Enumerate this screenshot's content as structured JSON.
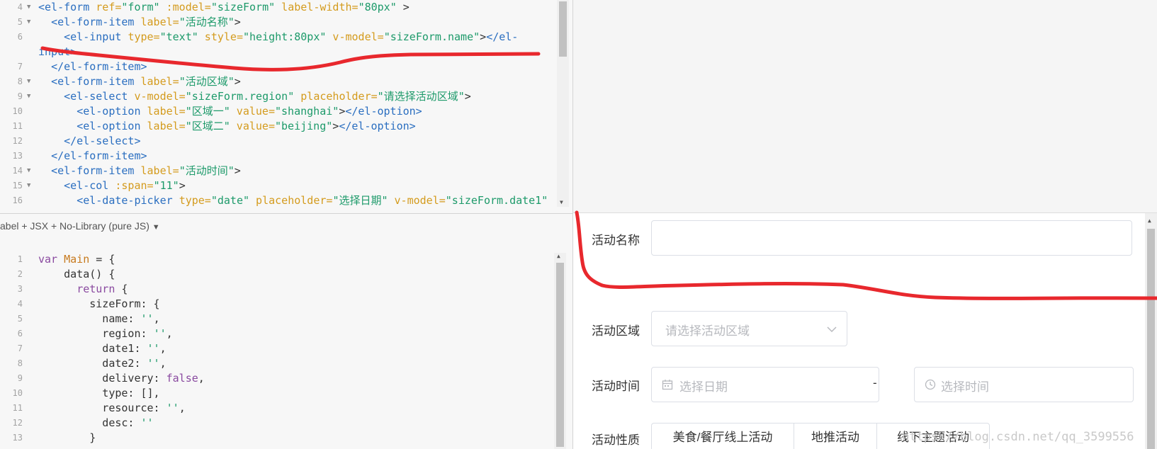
{
  "html_editor": {
    "lines": [
      {
        "n": "4",
        "fold": true,
        "segs": [
          [
            "tag",
            "<el-form "
          ],
          [
            "attr",
            "ref="
          ],
          [
            "str",
            "\"form\""
          ],
          [
            "attr",
            " :model="
          ],
          [
            "str",
            "\"sizeForm\""
          ],
          [
            "attr",
            " label-width="
          ],
          [
            "str",
            "\"80px\""
          ],
          [
            "pl",
            " >"
          ]
        ]
      },
      {
        "n": "5",
        "fold": true,
        "segs": [
          [
            "pl",
            "  "
          ],
          [
            "tag",
            "<el-form-item "
          ],
          [
            "attr",
            "label="
          ],
          [
            "str",
            "\"活动名称\""
          ],
          [
            "pl",
            ">"
          ]
        ]
      },
      {
        "n": "6",
        "fold": false,
        "segs": [
          [
            "pl",
            "    "
          ],
          [
            "tag",
            "<el-input "
          ],
          [
            "attr",
            "type="
          ],
          [
            "str",
            "\"text\""
          ],
          [
            "attr",
            " style="
          ],
          [
            "str",
            "\"height:80px\""
          ],
          [
            "attr",
            " v-model="
          ],
          [
            "str",
            "\"sizeForm.name\""
          ],
          [
            "pl",
            ">"
          ],
          [
            "tag",
            "</el-"
          ]
        ]
      },
      {
        "n": "",
        "fold": false,
        "segs": [
          [
            "tag",
            "input>"
          ]
        ]
      },
      {
        "n": "7",
        "fold": false,
        "segs": [
          [
            "pl",
            "  "
          ],
          [
            "tag",
            "</el-form-item>"
          ]
        ]
      },
      {
        "n": "8",
        "fold": true,
        "segs": [
          [
            "pl",
            "  "
          ],
          [
            "tag",
            "<el-form-item "
          ],
          [
            "attr",
            "label="
          ],
          [
            "str",
            "\"活动区域\""
          ],
          [
            "pl",
            ">"
          ]
        ]
      },
      {
        "n": "9",
        "fold": true,
        "segs": [
          [
            "pl",
            "    "
          ],
          [
            "tag",
            "<el-select "
          ],
          [
            "attr",
            "v-model="
          ],
          [
            "str",
            "\"sizeForm.region\""
          ],
          [
            "attr",
            " placeholder="
          ],
          [
            "str",
            "\"请选择活动区域\""
          ],
          [
            "pl",
            ">"
          ]
        ]
      },
      {
        "n": "10",
        "fold": false,
        "segs": [
          [
            "pl",
            "      "
          ],
          [
            "tag",
            "<el-option "
          ],
          [
            "attr",
            "label="
          ],
          [
            "str",
            "\"区域一\""
          ],
          [
            "attr",
            " value="
          ],
          [
            "str",
            "\"shanghai\""
          ],
          [
            "pl",
            ">"
          ],
          [
            "tag",
            "</el-option>"
          ]
        ]
      },
      {
        "n": "11",
        "fold": false,
        "segs": [
          [
            "pl",
            "      "
          ],
          [
            "tag",
            "<el-option "
          ],
          [
            "attr",
            "label="
          ],
          [
            "str",
            "\"区域二\""
          ],
          [
            "attr",
            " value="
          ],
          [
            "str",
            "\"beijing\""
          ],
          [
            "pl",
            ">"
          ],
          [
            "tag",
            "</el-option>"
          ]
        ]
      },
      {
        "n": "12",
        "fold": false,
        "segs": [
          [
            "pl",
            "    "
          ],
          [
            "tag",
            "</el-select>"
          ]
        ]
      },
      {
        "n": "13",
        "fold": false,
        "segs": [
          [
            "pl",
            "  "
          ],
          [
            "tag",
            "</el-form-item>"
          ]
        ]
      },
      {
        "n": "14",
        "fold": true,
        "segs": [
          [
            "pl",
            "  "
          ],
          [
            "tag",
            "<el-form-item "
          ],
          [
            "attr",
            "label="
          ],
          [
            "str",
            "\"活动时间\""
          ],
          [
            "pl",
            ">"
          ]
        ]
      },
      {
        "n": "15",
        "fold": true,
        "segs": [
          [
            "pl",
            "    "
          ],
          [
            "tag",
            "<el-col "
          ],
          [
            "attr",
            ":span="
          ],
          [
            "str",
            "\"11\""
          ],
          [
            "pl",
            ">"
          ]
        ]
      },
      {
        "n": "16",
        "fold": false,
        "segs": [
          [
            "pl",
            "      "
          ],
          [
            "tag",
            "<el-date-picker "
          ],
          [
            "attr",
            "type="
          ],
          [
            "str",
            "\"date\""
          ],
          [
            "attr",
            " placeholder="
          ],
          [
            "str",
            "\"选择日期\""
          ],
          [
            "attr",
            " v-model="
          ],
          [
            "str",
            "\"sizeForm.date1\""
          ]
        ]
      }
    ]
  },
  "js_editor": {
    "header": "abel + JSX + No-Library (pure JS)",
    "lines": [
      {
        "n": "1",
        "segs": [
          [
            "kw",
            "var "
          ],
          [
            "var",
            "Main"
          ],
          [
            "pl",
            " = {"
          ]
        ]
      },
      {
        "n": "2",
        "segs": [
          [
            "pl",
            "    data() {"
          ]
        ]
      },
      {
        "n": "3",
        "segs": [
          [
            "pl",
            "      "
          ],
          [
            "kw",
            "return"
          ],
          [
            "pl",
            " {"
          ]
        ]
      },
      {
        "n": "4",
        "segs": [
          [
            "pl",
            "        sizeForm: {"
          ]
        ]
      },
      {
        "n": "5",
        "segs": [
          [
            "pl",
            "          name: "
          ],
          [
            "str",
            "''"
          ],
          [
            "pl",
            ","
          ]
        ]
      },
      {
        "n": "6",
        "segs": [
          [
            "pl",
            "          region: "
          ],
          [
            "str",
            "''"
          ],
          [
            "pl",
            ","
          ]
        ]
      },
      {
        "n": "7",
        "segs": [
          [
            "pl",
            "          date1: "
          ],
          [
            "str",
            "''"
          ],
          [
            "pl",
            ","
          ]
        ]
      },
      {
        "n": "8",
        "segs": [
          [
            "pl",
            "          date2: "
          ],
          [
            "str",
            "''"
          ],
          [
            "pl",
            ","
          ]
        ]
      },
      {
        "n": "9",
        "segs": [
          [
            "pl",
            "          delivery: "
          ],
          [
            "kw",
            "false"
          ],
          [
            "pl",
            ","
          ]
        ]
      },
      {
        "n": "10",
        "segs": [
          [
            "pl",
            "          type: [],"
          ]
        ]
      },
      {
        "n": "11",
        "segs": [
          [
            "pl",
            "          resource: "
          ],
          [
            "str",
            "''"
          ],
          [
            "pl",
            ","
          ]
        ]
      },
      {
        "n": "12",
        "segs": [
          [
            "pl",
            "          desc: "
          ],
          [
            "str",
            "''"
          ]
        ]
      },
      {
        "n": "13",
        "segs": [
          [
            "pl",
            "        }"
          ]
        ]
      }
    ]
  },
  "preview": {
    "name_label": "活动名称",
    "name_value": "",
    "region_label": "活动区域",
    "region_placeholder": "请选择活动区域",
    "time_label": "活动时间",
    "date_placeholder": "选择日期",
    "time_separator": "-",
    "time_placeholder": "选择时间",
    "nature_label": "活动性质",
    "nature_options": [
      "美食/餐厅线上活动",
      "地推活动",
      "线下主题活动"
    ],
    "watermark": "https://blog.csdn.net/qq_3599556"
  },
  "colors": {
    "annotation": "#e8282d",
    "tag": "#2a6ec0",
    "attr": "#d49b1d",
    "string": "#1d9a6a"
  }
}
